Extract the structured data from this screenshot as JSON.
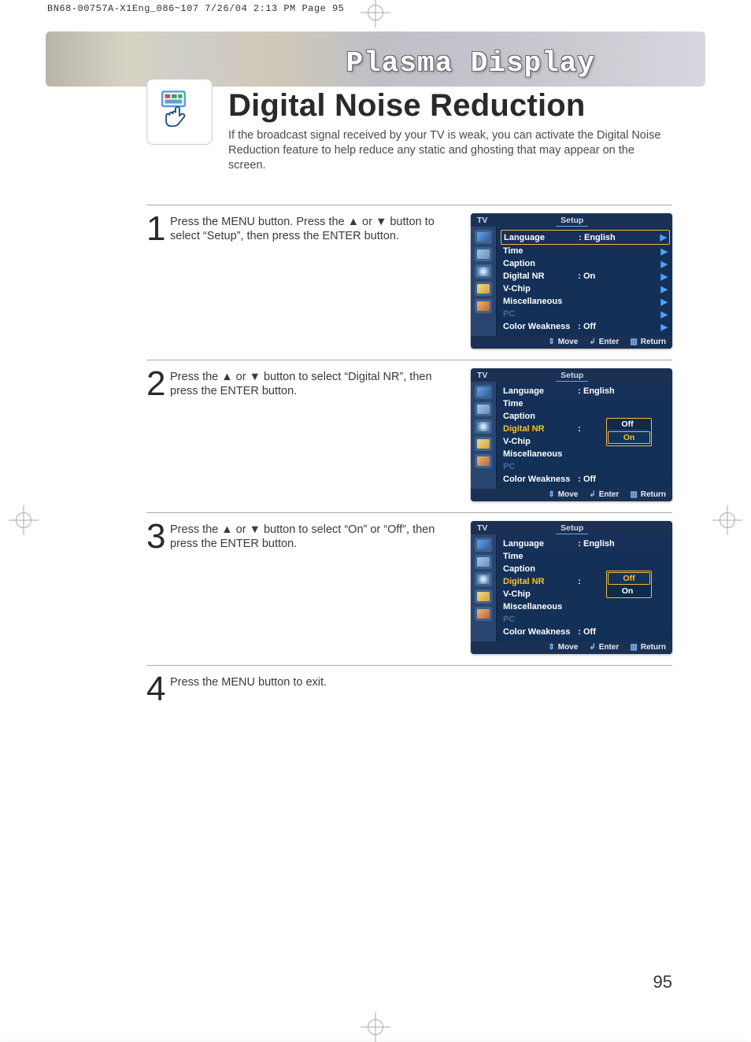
{
  "print_meta": "BN68-00757A-X1Eng_086~107  7/26/04  2:13 PM  Page 95",
  "banner": "Plasma Display",
  "title": "Digital Noise Reduction",
  "intro": "If the broadcast signal received by your TV is weak, you can activate the Digital Noise Reduction feature to help reduce any static and ghosting that may appear on the screen.",
  "steps": {
    "s1": {
      "num": "1",
      "text": "Press the MENU button. Press the ▲ or ▼ button to select “Setup”, then press the ENTER button."
    },
    "s2": {
      "num": "2",
      "text": "Press the ▲ or ▼ button to select “Digital NR”, then press the ENTER button."
    },
    "s3": {
      "num": "3",
      "text": "Press the ▲ or ▼ button to select “On” or “Off”, then press the ENTER button."
    },
    "s4": {
      "num": "4",
      "text": "Press the MENU button to exit."
    }
  },
  "osd": {
    "header_left": "TV",
    "header_right": "Setup",
    "items": {
      "language": "Language",
      "time": "Time",
      "caption": "Caption",
      "digital_nr": "Digital NR",
      "vchip": "V-Chip",
      "misc": "Miscellaneous",
      "pc": "PC",
      "color_weak": "Color Weakness"
    },
    "values": {
      "english": "English",
      "on": "On",
      "off": "Off"
    },
    "colon": ":",
    "arrow": "▶",
    "options": {
      "off": "Off",
      "on": "On"
    },
    "footer": {
      "move": "Move",
      "enter": "Enter",
      "return": "Return",
      "up_down": "⇕",
      "enter_icon": "↲",
      "return_icon": "▥"
    }
  },
  "page_number": "95"
}
